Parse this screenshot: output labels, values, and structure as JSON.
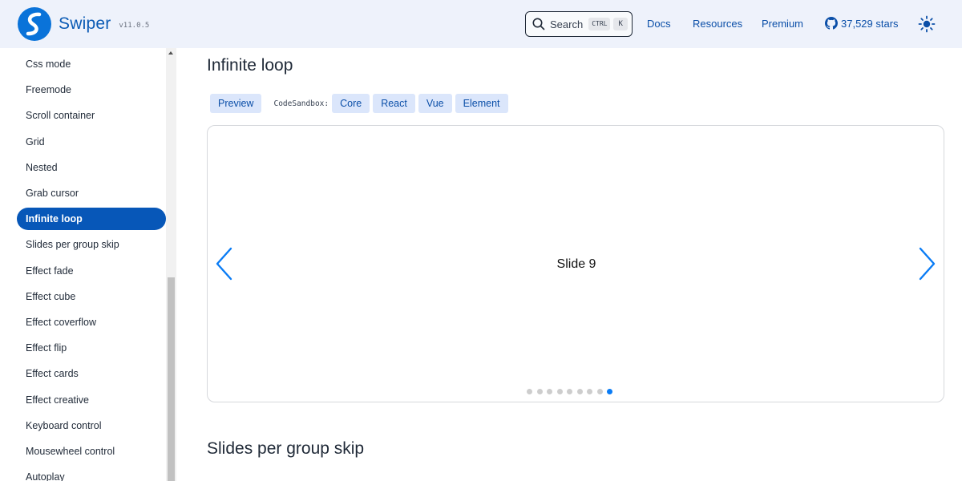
{
  "header": {
    "logo_text": "Swiper",
    "version": "v11.0.5",
    "search_label": "Search",
    "search_kbd_ctrl": "CTRL",
    "search_kbd_key": "K",
    "nav": [
      "Docs",
      "Resources",
      "Premium"
    ],
    "stars": "37,529 stars"
  },
  "sidebar": {
    "items": [
      "Css mode",
      "Freemode",
      "Scroll container",
      "Grid",
      "Nested",
      "Grab cursor",
      "Infinite loop",
      "Slides per group skip",
      "Effect fade",
      "Effect cube",
      "Effect coverflow",
      "Effect flip",
      "Effect cards",
      "Effect creative",
      "Keyboard control",
      "Mousewheel control",
      "Autoplay"
    ],
    "active_index": 6
  },
  "main": {
    "section_title": "Infinite loop",
    "next_section_title": "Slides per group skip",
    "preview_label": "Preview",
    "codesandbox_label": "CodeSandbox:",
    "frameworks": [
      "Core",
      "React",
      "Vue",
      "Element"
    ],
    "slide_text": "Slide 9",
    "pagination_count": 9,
    "pagination_active": 8
  },
  "colors": {
    "accent": "#0757b8",
    "swiper_blue": "#0a7cf5",
    "chip_bg": "#dbe6fb",
    "header_bg": "#eef2fb"
  },
  "icons": {
    "logo": "swiper-logo-icon",
    "search": "search-icon",
    "github": "github-icon",
    "theme": "sun-icon",
    "prev": "chevron-left-icon",
    "next": "chevron-right-icon"
  }
}
